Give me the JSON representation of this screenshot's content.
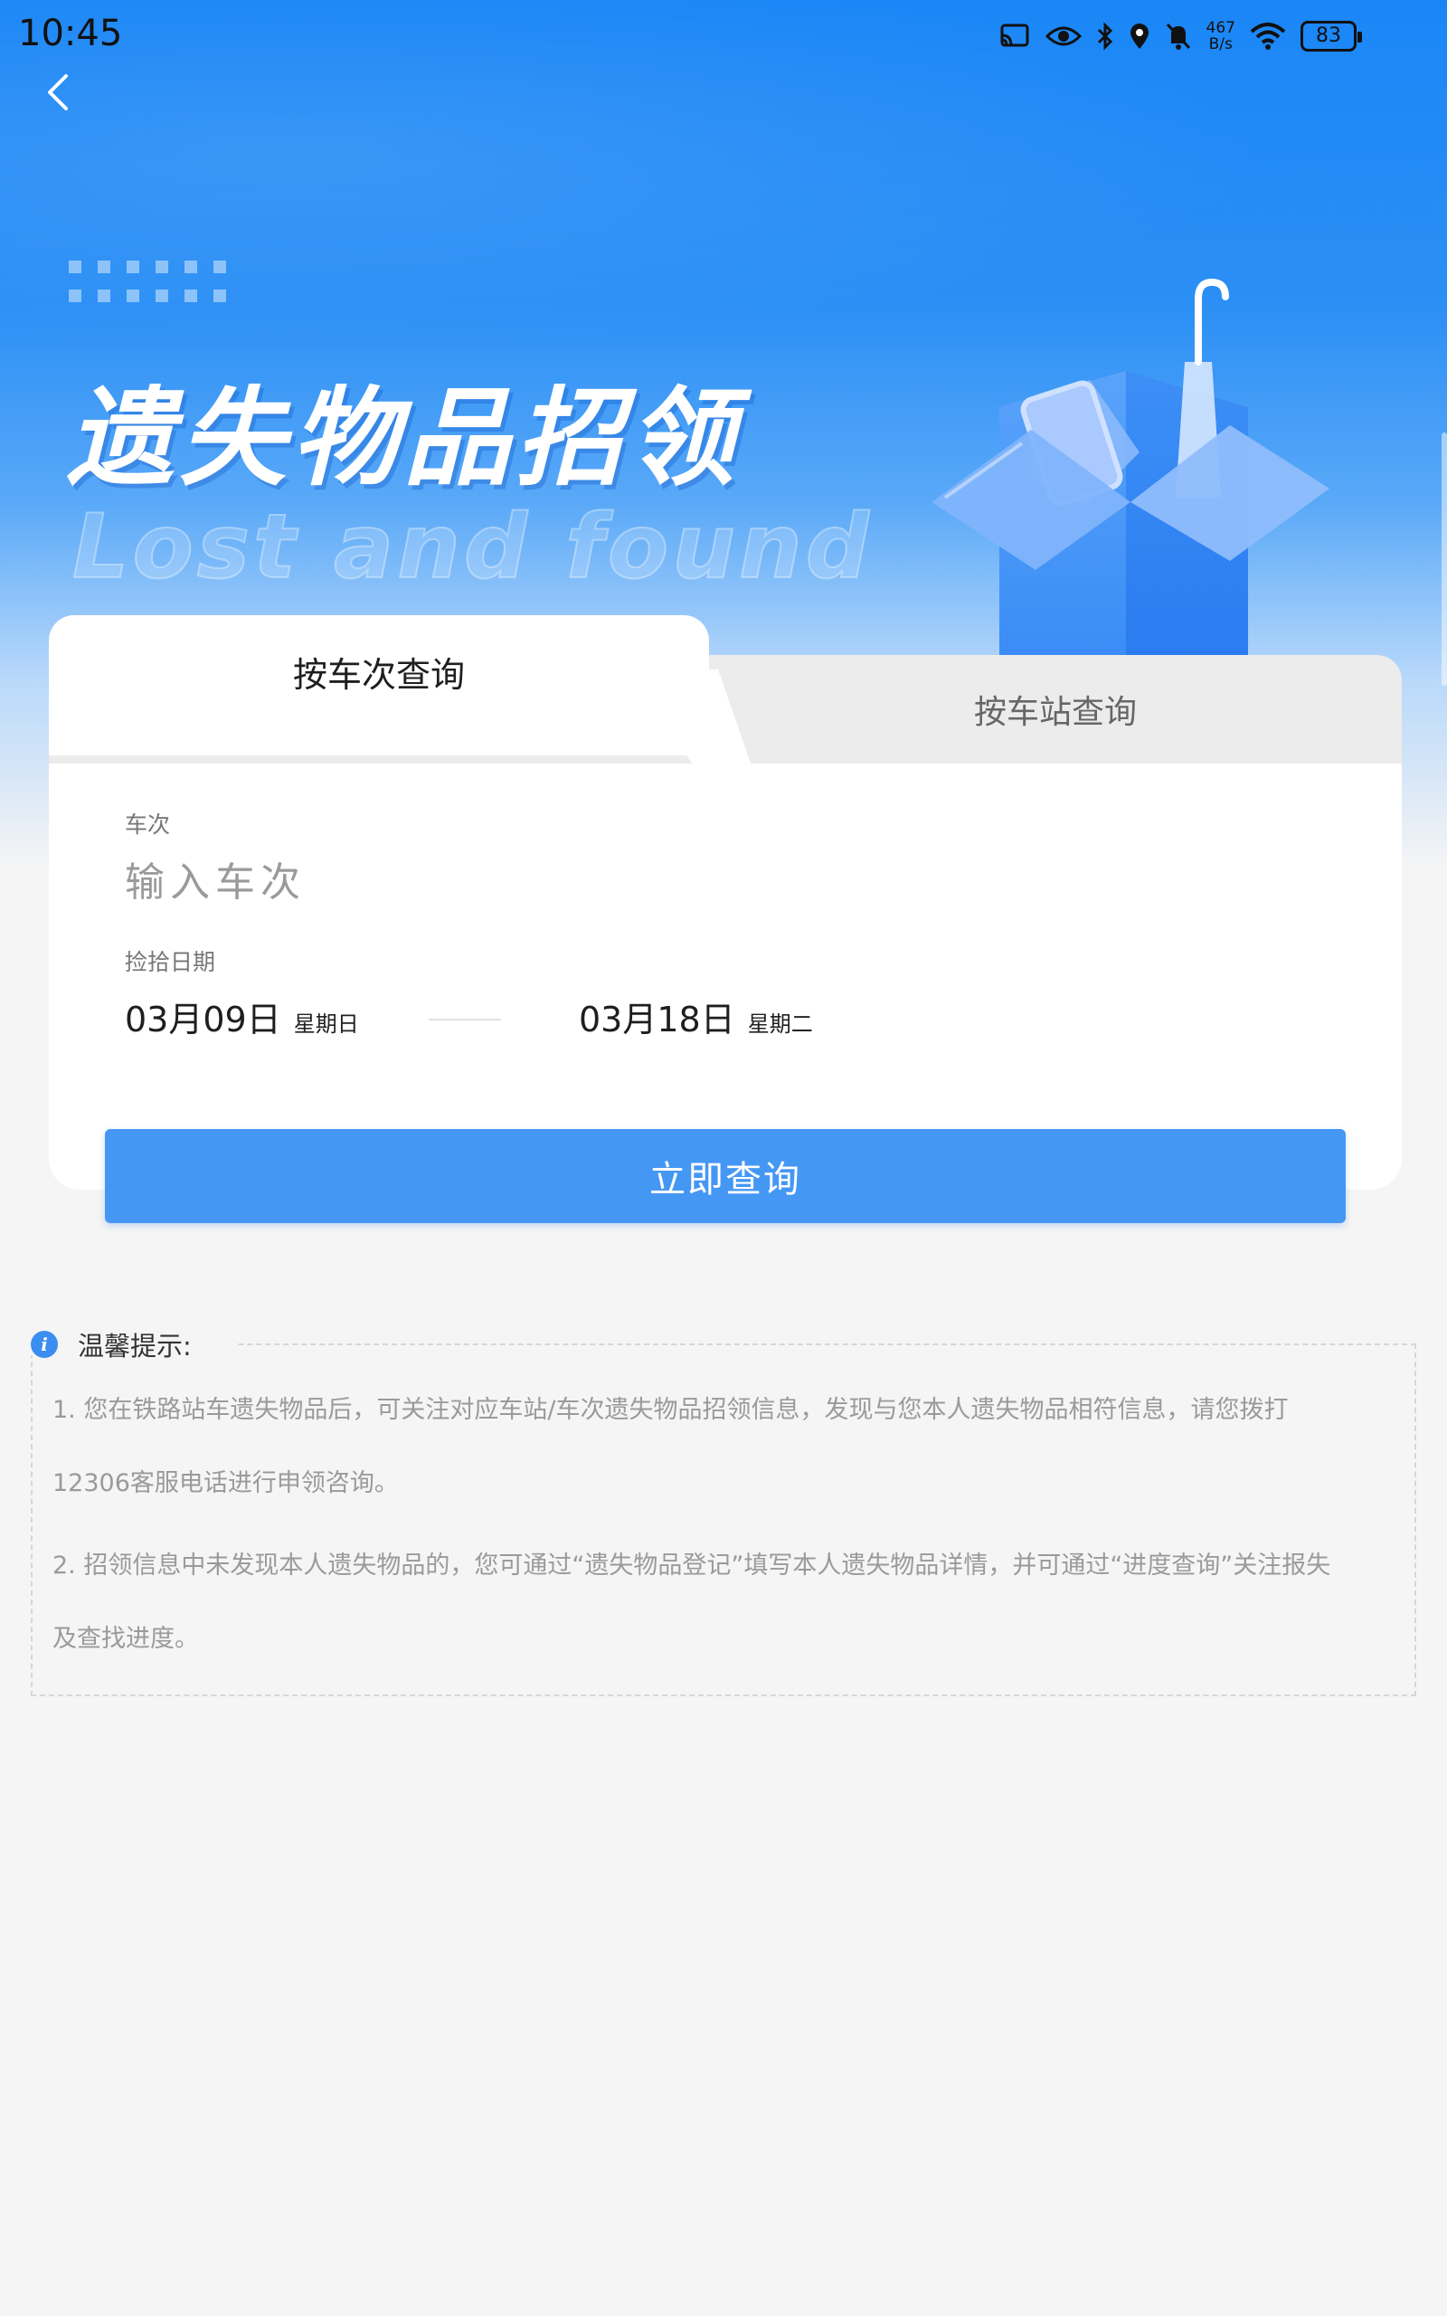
{
  "status_bar": {
    "time": "10:45",
    "net_speed_value": "467",
    "net_speed_unit": "B/s",
    "battery": "83"
  },
  "banner": {
    "title": "遗失物品招领",
    "subtitle": "Lost and found"
  },
  "tabs": [
    {
      "label": "按车次查询",
      "active": true
    },
    {
      "label": "按车站查询",
      "active": false
    }
  ],
  "form": {
    "train_label": "车次",
    "train_placeholder": "输入车次",
    "date_label": "捡拾日期",
    "start_date": "03月09日",
    "start_weekday": "星期日",
    "end_date": "03月18日",
    "end_weekday": "星期二",
    "submit_label": "立即查询"
  },
  "tips": {
    "title": "温馨提示:",
    "lines": [
      "1. 您在铁路站车遗失物品后，可关注对应车站/车次遗失物品招领信息，发现与您本人遗失物品相符信息，请您拨打",
      "12306客服电话进行申领咨询。",
      "2. 招领信息中未发现本人遗失物品的，您可通过“遗失物品登记”填写本人遗失物品详情，并可通过“进度查询”关注报失",
      "及查找进度。"
    ]
  },
  "colors": {
    "primary": "#4597f4",
    "hero_blue": "#1a86f6",
    "page_bg": "#f5f5f5"
  }
}
